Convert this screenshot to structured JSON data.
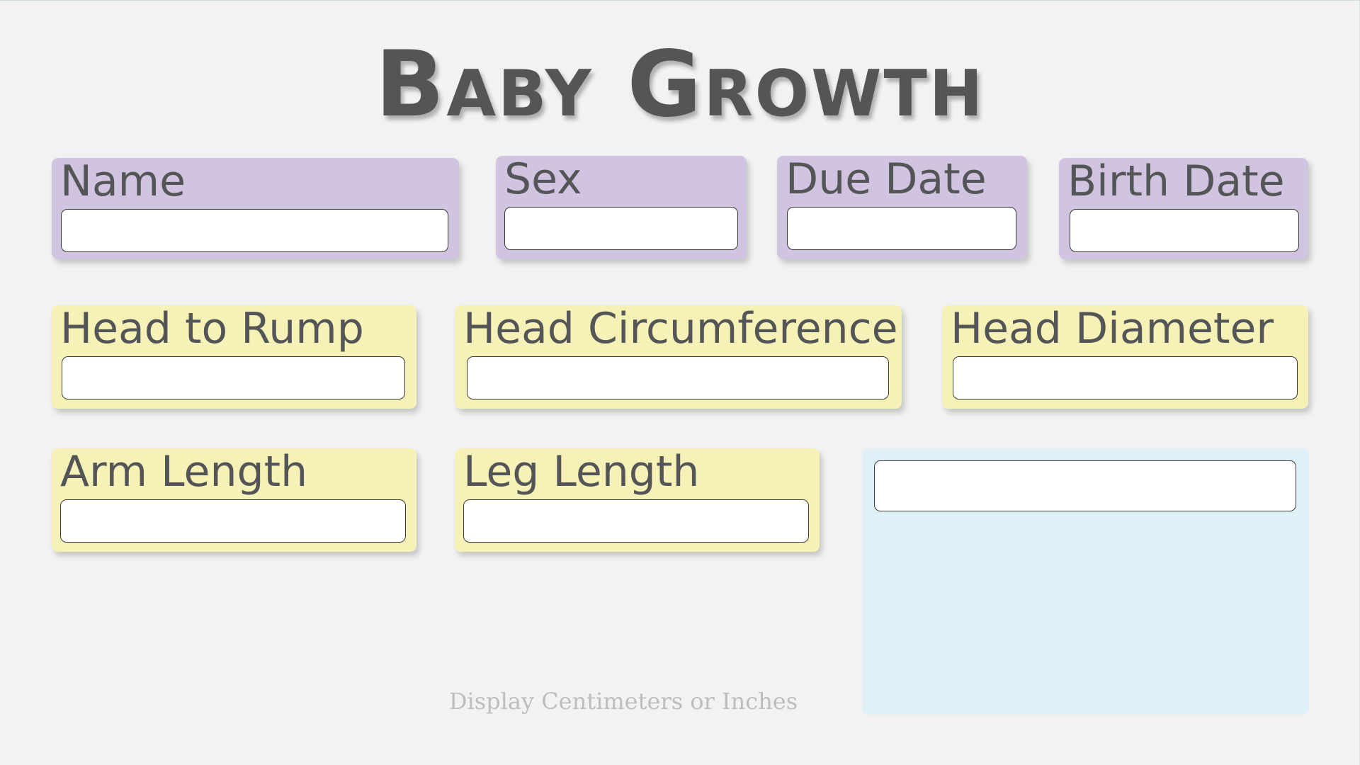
{
  "title": "Baby Growth",
  "fields": {
    "name": {
      "label": "Name",
      "value": ""
    },
    "sex": {
      "label": "Sex",
      "value": ""
    },
    "due_date": {
      "label": "Due Date",
      "value": ""
    },
    "birth_date": {
      "label": "Birth Date",
      "value": ""
    },
    "head_to_rump": {
      "label": "Head to Rump",
      "value": ""
    },
    "head_circumference": {
      "label": "Head Circumference",
      "value": ""
    },
    "head_diameter": {
      "label": "Head Diameter",
      "value": ""
    },
    "arm_length": {
      "label": "Arm Length",
      "value": ""
    },
    "leg_length": {
      "label": "Leg Length",
      "value": ""
    },
    "notes": {
      "value": ""
    }
  },
  "unit_toggle_label": "Display Centimeters or Inches",
  "colors": {
    "background": "#f2f2f2",
    "purple_card": "#d1c4e0",
    "yellow_card": "#f6f2b7",
    "blue_panel": "#dff0f6",
    "text": "#545557"
  }
}
